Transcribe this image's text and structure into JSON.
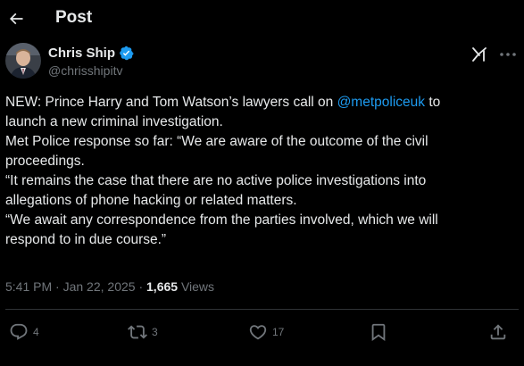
{
  "header": {
    "title": "Post"
  },
  "author": {
    "name": "Chris Ship",
    "handle": "@chrisshipitv"
  },
  "post": {
    "line1_pre": "NEW: Prince Harry and Tom Watson’s lawyers call on ",
    "mention": "@metpoliceuk",
    "line1_post": " to",
    "line2": "launch a new criminal investigation.",
    "line3": "Met Police response so far: “We are aware of the outcome of the civil",
    "line4": "proceedings.",
    "line5": "“It remains the case that there are no active police investigations into",
    "line6": "allegations of phone hacking or related matters.",
    "line7": "“We await any correspondence from the parties involved, which we will",
    "line8": "respond to in due course.”"
  },
  "meta": {
    "time": "5:41 PM",
    "separator": "·",
    "date": "Jan 22, 2025",
    "views_count": "1,665",
    "views_label": "Views"
  },
  "actions": {
    "replies": "4",
    "reposts": "3",
    "likes": "17"
  },
  "icons": {
    "back": "arrow-left-icon",
    "verified": "verified-badge-icon",
    "grok": "grok-icon",
    "more": "more-icon",
    "reply": "reply-icon",
    "repost": "repost-icon",
    "like": "heart-icon",
    "bookmark": "bookmark-icon",
    "share": "share-icon"
  },
  "colors": {
    "background": "#000000",
    "text": "#e7e9ea",
    "muted": "#71767b",
    "link": "#1d9bf0",
    "verified": "#1d9bf0",
    "divider": "#2f3336"
  }
}
